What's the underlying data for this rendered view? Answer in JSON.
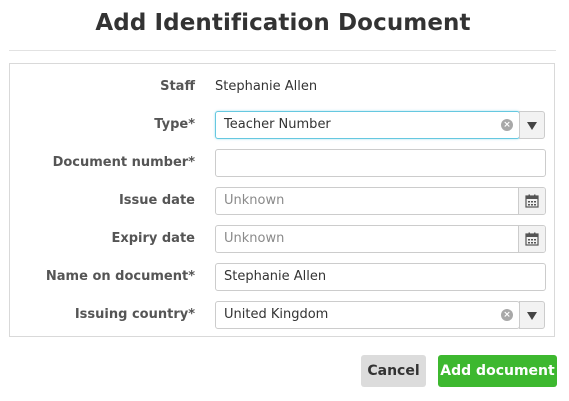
{
  "dialog": {
    "title": "Add Identification Document"
  },
  "form": {
    "staff": {
      "label": "Staff",
      "value": "Stephanie Allen"
    },
    "type": {
      "label": "Type*",
      "value": "Teacher Number"
    },
    "document_number": {
      "label": "Document number*",
      "value": ""
    },
    "issue_date": {
      "label": "Issue date",
      "placeholder": "Unknown"
    },
    "expiry_date": {
      "label": "Expiry date",
      "placeholder": "Unknown"
    },
    "name_on_document": {
      "label": "Name on document*",
      "value": "Stephanie Allen"
    },
    "issuing_country": {
      "label": "Issuing country*",
      "value": "United Kingdom"
    }
  },
  "icons": {
    "clear": "clear-icon",
    "dropdown": "chevron-down-icon",
    "calendar": "calendar-icon"
  },
  "actions": {
    "cancel_label": "Cancel",
    "add_label": "Add document"
  },
  "colors": {
    "primary_button": "#3db82f",
    "secondary_button": "#dcdcdc",
    "focus_border": "#66c8e0"
  }
}
